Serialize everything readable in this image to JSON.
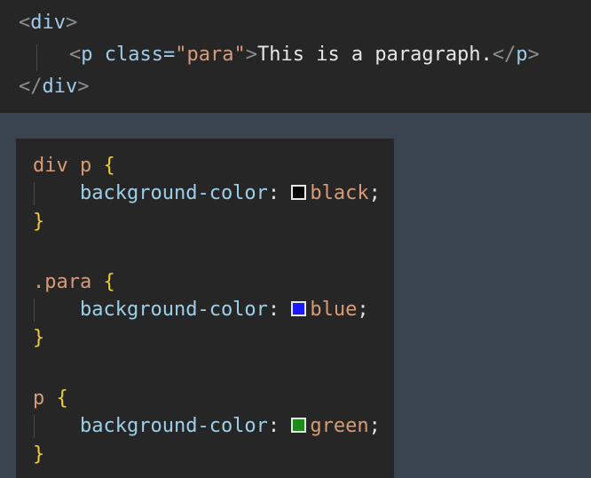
{
  "html_code": {
    "lines": [
      {
        "open_lt": "<",
        "tag": "div",
        "gt": ">"
      },
      {
        "open_lt": "<",
        "tag": "p",
        "attr": "class",
        "eq": "=",
        "value": "\"para\"",
        "gt": ">",
        "text": "This is a paragraph.",
        "close_lt": "</",
        "close_tag": "p",
        "close_gt": ">"
      },
      {
        "open_lt": "</",
        "tag": "div",
        "gt": ">"
      }
    ]
  },
  "css_code": {
    "rules": [
      {
        "selector": "div p",
        "open": "{",
        "property": "background-color",
        "colon": ":",
        "value": "black",
        "semi": ";",
        "close": "}",
        "swatch_color": "#000000"
      },
      {
        "selector": ".para",
        "open": "{",
        "property": "background-color",
        "colon": ":",
        "value": "blue",
        "semi": ";",
        "close": "}",
        "swatch_color": "#1a1aff"
      },
      {
        "selector": "p",
        "open": "{",
        "property": "background-color",
        "colon": ":",
        "value": "green",
        "semi": ";",
        "close": "}",
        "swatch_color": "#1e8a1e"
      }
    ]
  },
  "colors": {
    "background": "#3a4450",
    "panel": "#272627"
  }
}
